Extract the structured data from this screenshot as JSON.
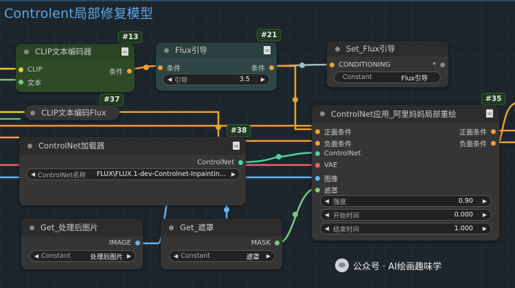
{
  "group_title": "Controlent局部修复模型",
  "badges": {
    "n13": "#13",
    "n21": "#21",
    "n37": "#37",
    "n38": "#38",
    "n35": "#35"
  },
  "clip_encode": {
    "title": "CLIP文本编码器",
    "in_clip": "CLIP",
    "in_text": "文本",
    "out_cond": "条件"
  },
  "flux_guidance": {
    "title": "Flux引导",
    "in_cond": "条件",
    "out_cond": "条件",
    "widget_label": "引导",
    "widget_value": "3.5"
  },
  "set_flux": {
    "title": "Set_Flux引导",
    "in_cond": "CONDITIONING",
    "out_star": "*",
    "widget_label": "Constant",
    "widget_value": "Flux引导"
  },
  "clip_flux": {
    "title": "CLIP文本编码Flux"
  },
  "controlnet_apply": {
    "title": "ControlNet应用_阿里妈妈局部重绘",
    "in_pos": "正面条件",
    "in_neg": "负面条件",
    "in_cn": "ControlNet",
    "in_vae": "VAE",
    "in_img": "图像",
    "in_mask": "遮罩",
    "out_pos": "正面条件",
    "out_neg": "负面条件",
    "strength_label": "强度",
    "strength_value": "0.90",
    "start_label": "开始时间",
    "start_value": "0.000",
    "end_label": "结束时间",
    "end_value": "1.000"
  },
  "controlnet_loader": {
    "title": "ControlNet加载器",
    "out_cn": "ControlNet",
    "widget_label": "ControlNet名称",
    "widget_value": "FLUX\\FLUX.1-dev-Controlnet-Inpaintin..."
  },
  "get_image": {
    "title": "Get_处理后图片",
    "out": "IMAGE",
    "widget_label": "Constant",
    "widget_value": "处理后图片"
  },
  "get_mask": {
    "title": "Get_遮罩",
    "out": "MASK",
    "widget_label": "Constant",
    "widget_value": "遮罩"
  },
  "watermark": {
    "text": "公众号 · AI绘画趣味学"
  },
  "colors": {
    "cond": "#f0a030",
    "clip": "#f5d020",
    "cn": "#4fd0a0",
    "vae": "#f06070",
    "image": "#64b5f6",
    "mask": "#7ec87e",
    "group_title": "#5aa6e6",
    "badge_bg": "#1f3a1f"
  }
}
